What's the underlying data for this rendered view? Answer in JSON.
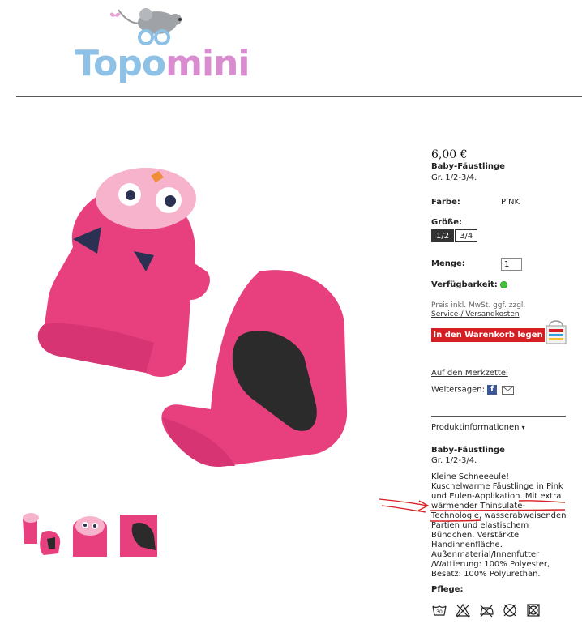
{
  "brand": {
    "part1": "Topo",
    "part2": "mini"
  },
  "product": {
    "price": "6,00 €",
    "name": "Baby-Fäustlinge",
    "size_note": "Gr. 1/2-3/4.",
    "color_label": "Farbe:",
    "color_value": "PINK",
    "size_label": "Größe:",
    "sizes": [
      "1/2",
      "3/4"
    ],
    "selected_size": "1/2",
    "qty_label": "Menge:",
    "qty_value": "1",
    "availability_label": "Verfügbarkeit:",
    "price_note": "Preis inkl. MwSt. ggf. zzgl.",
    "shipping_link": "Service-/ Versandkosten",
    "cart_button": "In den Warenkorb legen",
    "wishlist_link": "Auf den Merkzettel",
    "share_label": "Weitersagen:",
    "info_toggle": "Produktinformationen",
    "info_title": "Baby-Fäustlinge",
    "info_size": "Gr. 1/2-3/4.",
    "description": [
      "Kleine Schneeeule!",
      "Kuschelwarme Fäustlinge in Pink",
      "und Eulen-Applikation. Mit extra",
      "wärmender Thinsulate-",
      "Technologie, wasserabweisenden",
      "Partien und elastischem",
      "Bündchen. Verstärkte",
      "Handinnenfläche.",
      "Außenmaterial/Innenfutter",
      "/Wattierung: 100% Polyester,",
      "Besatz: 100% Polyurethan."
    ],
    "care_label": "Pflege:",
    "care_icons": [
      "wash-30-icon",
      "no-bleach-icon",
      "no-iron-icon",
      "no-dryclean-icon",
      "no-tumble-dry-icon"
    ],
    "care_wash_temp": "30"
  },
  "colors": {
    "accent_red": "#d61f23",
    "pink": "#e8407f",
    "available_green": "#43c23a"
  }
}
